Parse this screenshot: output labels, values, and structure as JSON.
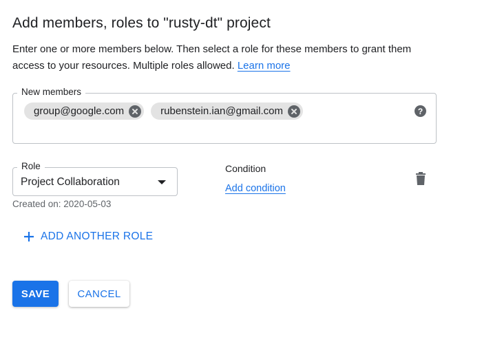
{
  "dialog": {
    "title": "Add members, roles to \"rusty-dt\" project",
    "description": "Enter one or more members below. Then select a role for these members to grant them access to your resources. Multiple roles allowed.",
    "learn_more": "Learn more"
  },
  "members": {
    "label": "New members",
    "chips": [
      "group@google.com",
      "rubenstein.ian@gmail.com"
    ],
    "help_icon": "help-icon",
    "help_glyph": "?"
  },
  "role": {
    "label": "Role",
    "value": "Project Collaboration",
    "created": "Created on: 2020-05-03"
  },
  "condition": {
    "label": "Condition",
    "add_link": "Add condition"
  },
  "actions": {
    "add_another_role": "ADD ANOTHER ROLE",
    "save": "SAVE",
    "cancel": "CANCEL"
  },
  "colors": {
    "accent": "#1a73e8",
    "chip_bg": "#e3e3e3",
    "icon_gray": "#5f6368"
  }
}
